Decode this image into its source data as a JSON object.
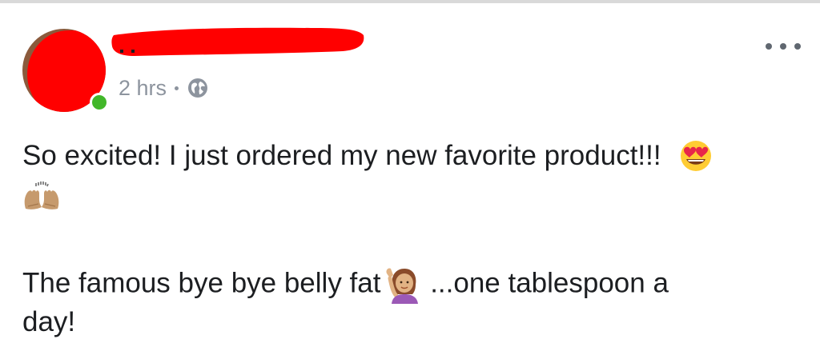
{
  "post": {
    "timestamp": "2 hrs",
    "privacy_icon": "globe-icon",
    "menu_icon": "more-options-icon",
    "text": {
      "line1": "So excited! I just ordered my new favorite product!!!",
      "line3_a": "The famous bye bye belly fat",
      "line3_b": " ...one tablespoon a",
      "line4": "day!"
    },
    "emojis": [
      "heart-eyes-emoji",
      "raising-hands-emoji",
      "tipping-hand-woman-emoji"
    ]
  },
  "colors": {
    "redaction": "#ff0000",
    "meta_text": "#8d949e",
    "body_text": "#1c1e21",
    "presence": "#42b72a"
  }
}
